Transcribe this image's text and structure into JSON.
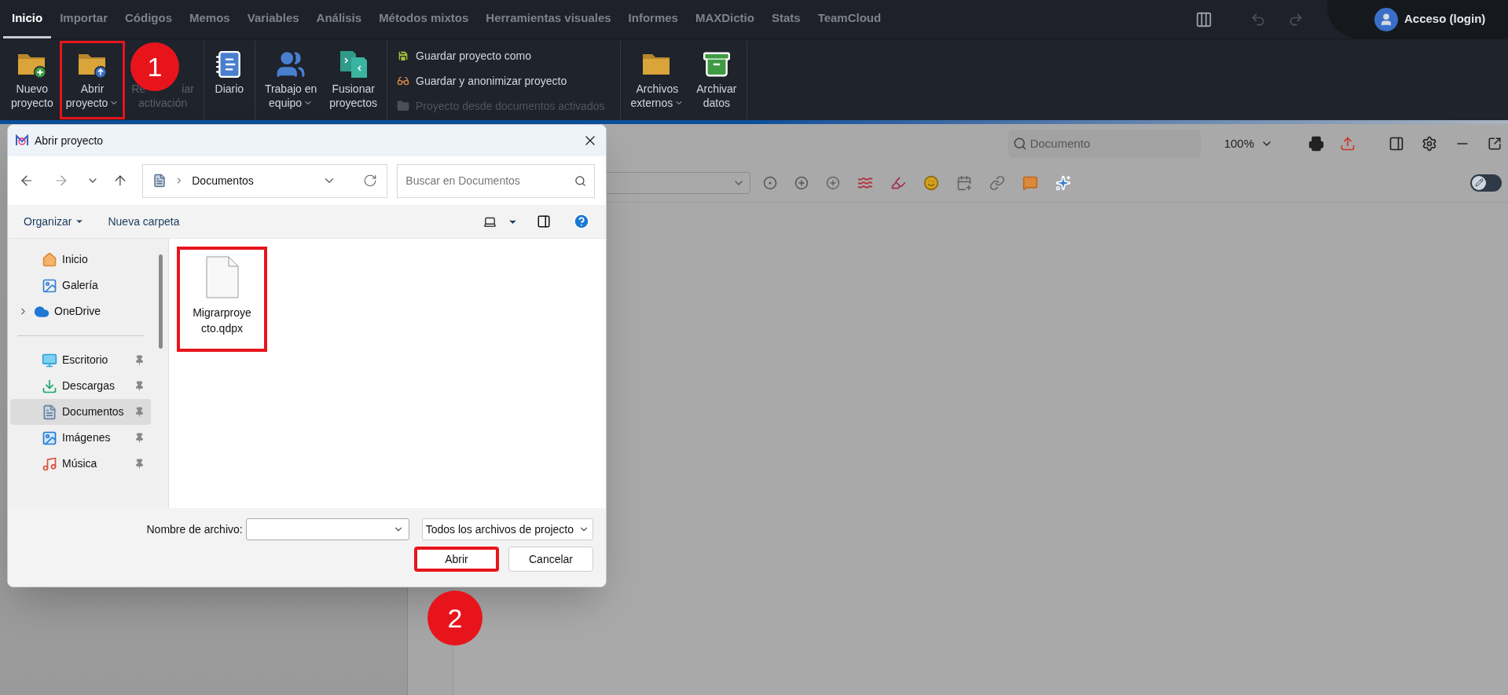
{
  "tabs": [
    {
      "label": "Inicio",
      "selected": true
    },
    {
      "label": "Importar",
      "selected": false
    },
    {
      "label": "Códigos",
      "selected": false
    },
    {
      "label": "Memos",
      "selected": false
    },
    {
      "label": "Variables",
      "selected": false
    },
    {
      "label": "Análisis",
      "selected": false
    },
    {
      "label": "Métodos mixtos",
      "selected": false
    },
    {
      "label": "Herramientas visuales",
      "selected": false
    },
    {
      "label": "Informes",
      "selected": false
    },
    {
      "label": "MAXDictio",
      "selected": false
    },
    {
      "label": "Stats",
      "selected": false
    },
    {
      "label": "TeamCloud",
      "selected": false
    }
  ],
  "account": {
    "label": "Acceso (login)"
  },
  "ribbon": {
    "groups": [
      {
        "kind": "large",
        "items": [
          {
            "lines": [
              [
                "Nuevo"
              ],
              [
                "proyecto"
              ]
            ],
            "dropdown": false,
            "disabled": false,
            "highlighted": false
          },
          {
            "lines": [
              [
                "Abrir"
              ],
              [
                "proyecto"
              ]
            ],
            "dropdown": true,
            "disabled": false,
            "highlighted": true
          },
          {
            "lines": [
              [
                "Re",
                "iar"
              ],
              [
                "activación"
              ]
            ],
            "dropdown": false,
            "disabled": true,
            "highlighted": false
          }
        ]
      },
      {
        "kind": "large",
        "items": [
          {
            "lines": [
              [
                "Diario"
              ]
            ],
            "dropdown": false,
            "disabled": false,
            "highlighted": false
          }
        ]
      },
      {
        "kind": "large",
        "items": [
          {
            "lines": [
              [
                "Trabajo en"
              ],
              [
                "equipo"
              ]
            ],
            "dropdown": true,
            "disabled": false,
            "highlighted": false
          },
          {
            "lines": [
              [
                "Fusionar"
              ],
              [
                "proyectos"
              ]
            ],
            "dropdown": false,
            "disabled": false,
            "highlighted": false
          }
        ]
      },
      {
        "kind": "stack",
        "items": [
          {
            "label": "Guardar proyecto como",
            "disabled": false
          },
          {
            "label": "Guardar y anonimizar proyecto",
            "disabled": false
          },
          {
            "label": "Proyecto desde documentos activados",
            "disabled": true
          }
        ]
      },
      {
        "kind": "large",
        "items": [
          {
            "lines": [
              [
                "Archivos"
              ],
              [
                "externos"
              ]
            ],
            "dropdown": true,
            "disabled": false,
            "highlighted": false
          },
          {
            "lines": [
              [
                "Archivar"
              ],
              [
                "datos"
              ]
            ],
            "dropdown": false,
            "disabled": false,
            "highlighted": false
          }
        ]
      }
    ]
  },
  "document_panel": {
    "search_placeholder": "Documento",
    "zoom": "100%",
    "edit_toggle": {
      "on": false
    }
  },
  "dialog": {
    "title": "Abrir proyecto",
    "path": "Documentos",
    "search_placeholder": "Buscar en Documentos",
    "commands": [
      {
        "label": "Organizar",
        "dropdown": true
      },
      {
        "label": "Nueva carpeta",
        "dropdown": false
      }
    ],
    "nav": [
      {
        "label": "Inicio",
        "selected": false,
        "pinned": false,
        "expandable": false
      },
      {
        "label": "Galería",
        "selected": false,
        "pinned": false,
        "expandable": false
      },
      {
        "label": "OneDrive",
        "selected": false,
        "pinned": false,
        "expandable": true
      },
      {
        "label": "Escritorio",
        "selected": false,
        "pinned": true,
        "expandable": false
      },
      {
        "label": "Descargas",
        "selected": false,
        "pinned": true,
        "expandable": false
      },
      {
        "label": "Documentos",
        "selected": true,
        "pinned": true,
        "expandable": false
      },
      {
        "label": "Imágenes",
        "selected": false,
        "pinned": true,
        "expandable": false
      },
      {
        "label": "Música",
        "selected": false,
        "pinned": true,
        "expandable": false
      }
    ],
    "files": [
      {
        "name": "Migrarproyecto.qdpx",
        "highlighted": true
      }
    ],
    "filename_label": "Nombre de archivo:",
    "filetype": "Todos los archivos de projecto",
    "buttons": [
      {
        "label": "Abrir",
        "kind": "primary",
        "highlighted": true
      },
      {
        "label": "Cancelar",
        "kind": "secondary",
        "highlighted": false
      }
    ]
  },
  "annotations": [
    {
      "label": "1"
    },
    {
      "label": "2"
    }
  ]
}
